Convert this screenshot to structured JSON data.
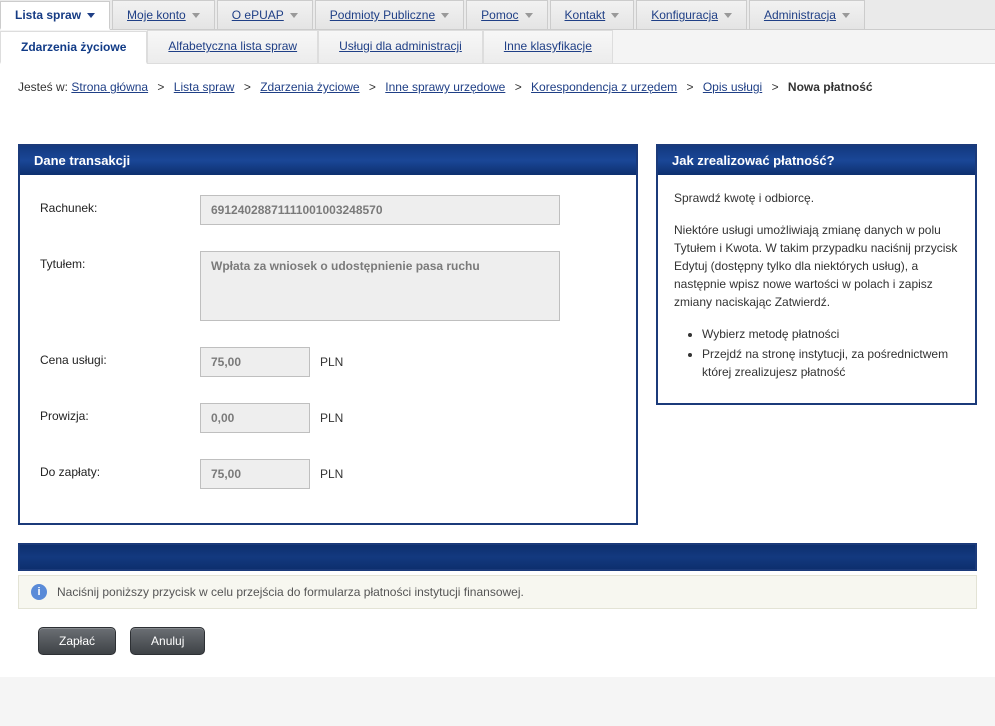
{
  "topNav": {
    "items": [
      {
        "label": "Lista spraw",
        "active": true
      },
      {
        "label": "Moje konto"
      },
      {
        "label": "O ePUAP"
      },
      {
        "label": "Podmioty Publiczne"
      },
      {
        "label": "Pomoc"
      },
      {
        "label": "Kontakt"
      },
      {
        "label": "Konfiguracja"
      },
      {
        "label": "Administracja"
      }
    ]
  },
  "subNav": {
    "items": [
      {
        "label": "Zdarzenia życiowe",
        "active": true
      },
      {
        "label": "Alfabetyczna lista spraw"
      },
      {
        "label": "Usługi dla administracji"
      },
      {
        "label": "Inne klasyfikacje"
      }
    ]
  },
  "breadcrumb": {
    "prefix": "Jesteś w:",
    "items": [
      "Strona główna",
      "Lista spraw",
      "Zdarzenia życiowe",
      "Inne sprawy urzędowe",
      "Korespondencja z urzędem",
      "Opis usługi"
    ],
    "current": "Nowa płatność"
  },
  "transaction": {
    "header": "Dane transakcji",
    "labels": {
      "account": "Rachunek:",
      "title": "Tytułem:",
      "price": "Cena usługi:",
      "commission": "Prowizja:",
      "toPay": "Do zapłaty:"
    },
    "values": {
      "account": "69124028871111001003248570",
      "title": "Wpłata za wniosek o udostępnienie pasa ruchu",
      "price": "75,00",
      "commission": "0,00",
      "toPay": "75,00"
    },
    "currency": "PLN"
  },
  "help": {
    "header": "Jak zrealizować płatność?",
    "p1": "Sprawdź kwotę i odbiorcę.",
    "p2": "Niektóre usługi umożliwiają zmianę danych w polu Tytułem i Kwota. W takim przypadku naciśnij przycisk Edytuj (dostępny tylko dla niektórych usług), a następnie wpisz nowe wartości w polach i zapisz zmiany naciskając Zatwierdź.",
    "steps": [
      "Wybierz metodę płatności",
      "Przejdź na stronę instytucji, za pośrednictwem której zrealizujesz płatność"
    ]
  },
  "bottom": {
    "info": "Naciśnij poniższy przycisk w celu przejścia do formularza płatności instytucji finansowej.",
    "payLabel": "Zapłać",
    "cancelLabel": "Anuluj"
  }
}
